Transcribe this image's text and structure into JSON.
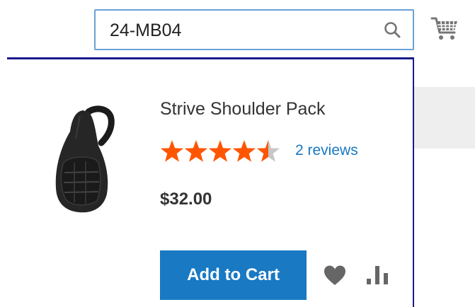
{
  "search": {
    "value": "24-MB04",
    "icon": "search-icon"
  },
  "header": {
    "cart_icon": "cart-icon"
  },
  "product": {
    "name": "Strive Shoulder Pack",
    "rating_fraction": 0.9,
    "reviews_label": "2 reviews",
    "price": "$32.00",
    "add_to_cart_label": "Add to Cart",
    "wishlist_icon": "heart-icon",
    "compare_icon": "compare-icon"
  },
  "colors": {
    "accent": "#1979c3",
    "stars": "#ff5501",
    "star_empty": "#c7c7c7",
    "dropdown_border": "#1a1a8c"
  }
}
